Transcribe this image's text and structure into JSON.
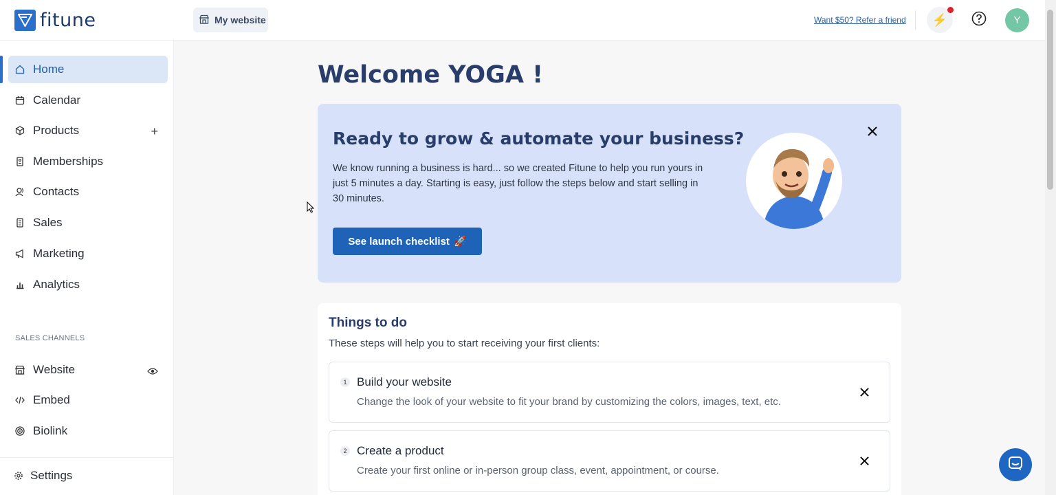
{
  "header": {
    "logo_text": "fitune",
    "site_button_label": "My website",
    "refer_link": "Want $50? Refer a friend",
    "avatar_initial": "Y"
  },
  "sidebar": {
    "items": [
      {
        "label": "Home",
        "icon": "home-icon",
        "active": true
      },
      {
        "label": "Calendar",
        "icon": "calendar-icon"
      },
      {
        "label": "Products",
        "icon": "box-icon",
        "trail": "+"
      },
      {
        "label": "Memberships",
        "icon": "membership-card-icon"
      },
      {
        "label": "Contacts",
        "icon": "contacts-icon"
      },
      {
        "label": "Sales",
        "icon": "receipt-icon"
      },
      {
        "label": "Marketing",
        "icon": "megaphone-icon"
      },
      {
        "label": "Analytics",
        "icon": "bar-chart-icon"
      }
    ],
    "section_label": "SALES CHANNELS",
    "channels": [
      {
        "label": "Website",
        "icon": "store-icon",
        "trail_icon": "eye-icon"
      },
      {
        "label": "Embed",
        "icon": "code-icon"
      },
      {
        "label": "Biolink",
        "icon": "target-icon"
      }
    ],
    "settings_label": "Settings"
  },
  "main": {
    "welcome": "Welcome YOGA !",
    "hero": {
      "title": "Ready to grow & automate your business?",
      "text": "We know running a business is hard... so we created Fitune to help you run yours in just 5 minutes a day. Starting is easy, just follow the steps below and start selling in 30 minutes.",
      "button_label": "See launch checklist",
      "button_emoji": "🚀"
    },
    "todo": {
      "title": "Things to do",
      "subtitle": "These steps will help you to start receiving your first clients:",
      "steps": [
        {
          "number": "1",
          "title": "Build your website",
          "description": "Change the look of your website to fit your brand by customizing the colors, images, text, etc."
        },
        {
          "number": "2",
          "title": "Create a product",
          "description": "Create your first online or in-person group class, event, appointment, or course."
        }
      ]
    }
  },
  "colors": {
    "accent": "#1e63b8",
    "heading": "#283d6a",
    "hero_bg": "#d7e2fa",
    "active_nav_bg": "#dbe6f6",
    "notification_dot": "#e0202f",
    "avatar_bg": "#74c7a5"
  }
}
